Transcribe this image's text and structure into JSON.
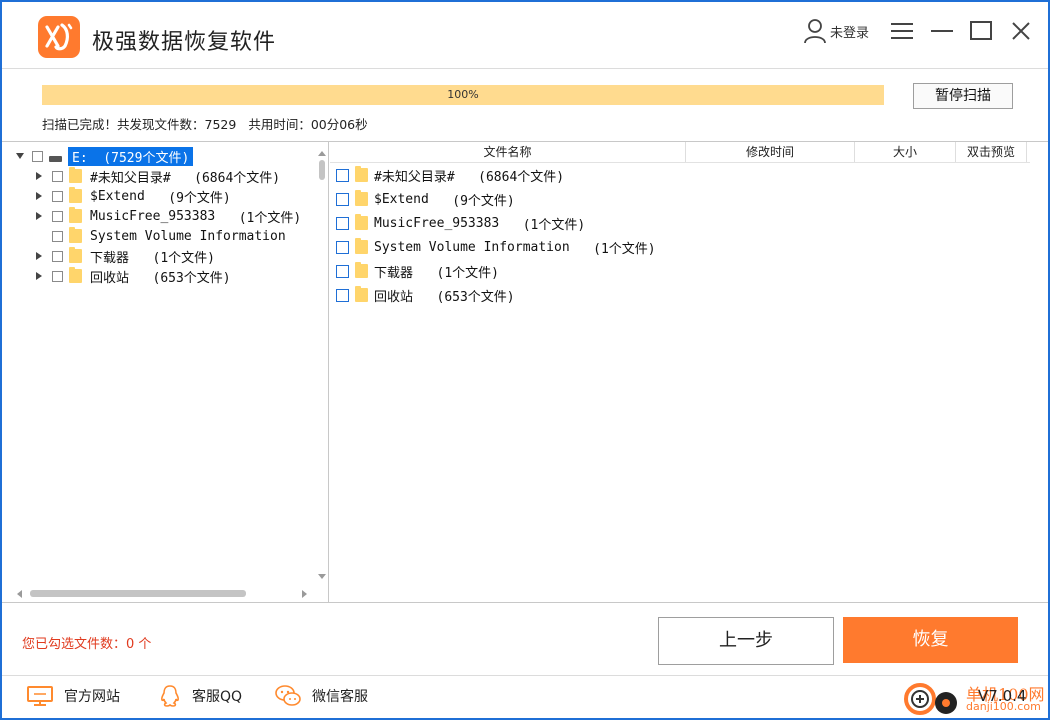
{
  "app": {
    "title": "极强数据恢复软件"
  },
  "header": {
    "login_label": "未登录"
  },
  "scan": {
    "progress_percent": 100,
    "progress_label": "100%",
    "pause_label": "暂停扫描",
    "status_done": "扫描已完成！",
    "status_found": "共发现文件数：7529",
    "status_time": "共用时间：00分06秒"
  },
  "tree": {
    "root_label": "E:  (7529个文件)",
    "items": [
      {
        "name": "#未知父目录#",
        "count": "(6864个文件)",
        "expandable": true
      },
      {
        "name": "$Extend",
        "count": "(9个文件)",
        "expandable": true
      },
      {
        "name": "MusicFree_953383",
        "count": "(1个文件)",
        "expandable": true
      },
      {
        "name": "System Volume Information",
        "count": "",
        "expandable": false
      },
      {
        "name": "下载器",
        "count": "(1个文件)",
        "expandable": true
      },
      {
        "name": "回收站",
        "count": "(653个文件)",
        "expandable": true
      }
    ]
  },
  "table": {
    "columns": [
      "文件名称",
      "修改时间",
      "大小",
      "双击预览"
    ],
    "rows": [
      {
        "name": "#未知父目录#",
        "count": "(6864个文件)"
      },
      {
        "name": "$Extend",
        "count": "(9个文件)"
      },
      {
        "name": "MusicFree_953383",
        "count": "(1个文件)"
      },
      {
        "name": "System Volume Information",
        "count": "(1个文件)"
      },
      {
        "name": "下载器",
        "count": "(1个文件)"
      },
      {
        "name": "回收站",
        "count": "(653个文件)"
      }
    ]
  },
  "footer": {
    "selected_text": "您已勾选文件数：0 个",
    "prev_label": "上一步",
    "restore_label": "恢复",
    "links": [
      "官方网站",
      "客服QQ",
      "微信客服"
    ],
    "version": "V7.0.4"
  },
  "watermark": {
    "line1": "单机100网",
    "line2": "danji100.com"
  },
  "colors": {
    "accent": "#ff7a2e",
    "selection": "#0a73e8",
    "progress": "#ffdb8f",
    "window_border": "#1f6fd6",
    "warning_text": "#e03a1e"
  }
}
